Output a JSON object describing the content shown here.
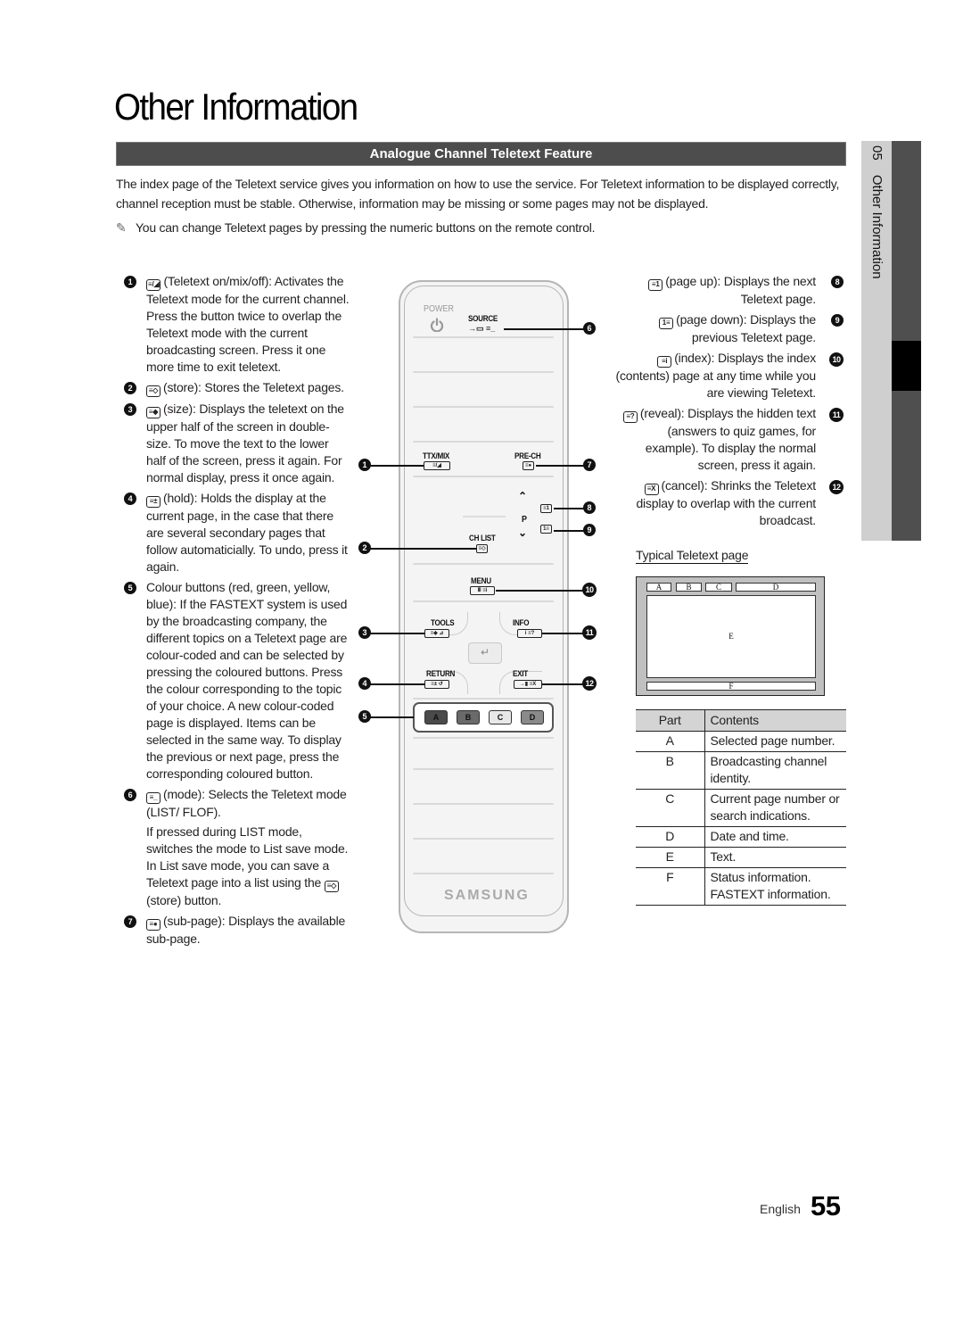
{
  "page": {
    "title": "Other Information",
    "section_title": "Analogue Channel Teletext Feature",
    "intro": "The index page of the Teletext service gives you information on how to use the service. For Teletext information to be displayed correctly, channel reception must be stable. Otherwise, information may be missing or some pages may not be displayed.",
    "note": "You can change Teletext pages by pressing the numeric buttons on the remote control.",
    "note_icon": "pencil-note-icon"
  },
  "side_tab": {
    "chapter_number": "05",
    "chapter_title": "Other Information"
  },
  "left_items": [
    {
      "num": "1",
      "icon": "teletext-mix-icon",
      "key": "≡/◢",
      "text": "(Teletext on/mix/off): Activates the Teletext mode for the current channel. Press the button twice to overlap the Teletext mode with the current broadcasting screen. Press it one more time to exit teletext."
    },
    {
      "num": "2",
      "icon": "store-icon",
      "key": "≡◇",
      "text": "(store): Stores the Teletext pages."
    },
    {
      "num": "3",
      "icon": "size-icon",
      "key": "≡◆",
      "text": "(size): Displays the teletext on the upper half of the screen in double-size. To move the text to the lower half of the screen, press it again. For normal display, press it once again."
    },
    {
      "num": "4",
      "icon": "hold-icon",
      "key": "≡±",
      "text": "(hold): Holds the display at the current page, in the case that there are several secondary pages that follow automaticially. To undo, press it again."
    },
    {
      "num": "5",
      "icon": "",
      "key": "",
      "text": "Colour buttons (red, green, yellow, blue): If the FASTEXT system is used by the broadcasting company, the different topics on a Teletext page are colour-coded and can be selected by pressing the coloured buttons. Press the colour corresponding to the topic of your choice. A new colour-coded page is displayed. Items can be selected in the same way. To display the previous or next page, press the corresponding coloured button."
    },
    {
      "num": "6",
      "icon": "mode-icon",
      "key": "≡_",
      "text": "(mode): Selects the Teletext mode (LIST/ FLOF).",
      "extra_before": "If pressed during LIST mode, switches the mode to List save mode. In List save mode, you can save a Teletext page into a list using the",
      "extra_key": "≡◇",
      "extra_after": "(store) button."
    },
    {
      "num": "7",
      "icon": "sub-page-icon",
      "key": "≡●",
      "text": "(sub-page): Displays the available sub-page."
    }
  ],
  "right_items": [
    {
      "num": "8",
      "icon": "page-up-icon",
      "key": "≡1",
      "text": "(page up): Displays the next Teletext page."
    },
    {
      "num": "9",
      "icon": "page-down-icon",
      "key": "1≡",
      "text": "(page down): Displays the previous Teletext page."
    },
    {
      "num": "10",
      "icon": "index-icon",
      "key": "≡i",
      "text": "(index): Displays the index (contents) page at any time while you are viewing Teletext."
    },
    {
      "num": "11",
      "icon": "reveal-icon",
      "key": "≡?",
      "text": "(reveal): Displays the hidden text (answers to quiz games, for example). To display the normal screen, press it again."
    },
    {
      "num": "12",
      "icon": "cancel-icon",
      "key": "≡X",
      "text": "(cancel): Shrinks the Teletext display to overlap with the current broadcast."
    }
  ],
  "remote": {
    "power_label": "POWER",
    "source_label": "SOURCE",
    "ttx_label": "TTX/MIX",
    "prech_label": "PRE-CH",
    "chlist_label": "CH LIST",
    "p_label": "P",
    "menu_label": "MENU",
    "tools_label": "TOOLS",
    "info_label": "INFO",
    "return_label": "RETURN",
    "exit_label": "EXIT",
    "brand": "SAMSUNG",
    "keys": {
      "source": "→▭ ≡_",
      "ttx": "≡/◢",
      "prech": "≡●",
      "page_up": "≡1",
      "page_down": "1≡",
      "chlist": "≡◇",
      "menu": "Ⅲ ≡i",
      "tools": "≡◆ ⊿",
      "info": "i ≡?",
      "return": "≡± ↺",
      "exit": "→▮ ≡X",
      "enter": "↵"
    },
    "color_buttons": [
      {
        "label": "A",
        "color": "#4a4a4a"
      },
      {
        "label": "B",
        "color": "#6a6a6a"
      },
      {
        "label": "C",
        "color": "#e8e8e8"
      },
      {
        "label": "D",
        "color": "#8a8a8a"
      }
    ],
    "callouts": [
      "1",
      "2",
      "3",
      "4",
      "5",
      "6",
      "7",
      "8",
      "9",
      "10",
      "11",
      "12"
    ]
  },
  "teletext_diagram": {
    "title": "Typical Teletext page",
    "boxes": {
      "a": "A",
      "b": "B",
      "c": "C",
      "d": "D",
      "e": "E",
      "f": "F"
    }
  },
  "parts_table": {
    "headers": [
      "Part",
      "Contents"
    ],
    "rows": [
      {
        "part": "A",
        "contents": "Selected page number."
      },
      {
        "part": "B",
        "contents": "Broadcasting channel identity."
      },
      {
        "part": "C",
        "contents": "Current page number or search indications."
      },
      {
        "part": "D",
        "contents": "Date and time."
      },
      {
        "part": "E",
        "contents": "Text."
      },
      {
        "part": "F",
        "contents": "Status information. FASTEXT information."
      }
    ]
  },
  "footer": {
    "language": "English",
    "page_number": "55"
  }
}
